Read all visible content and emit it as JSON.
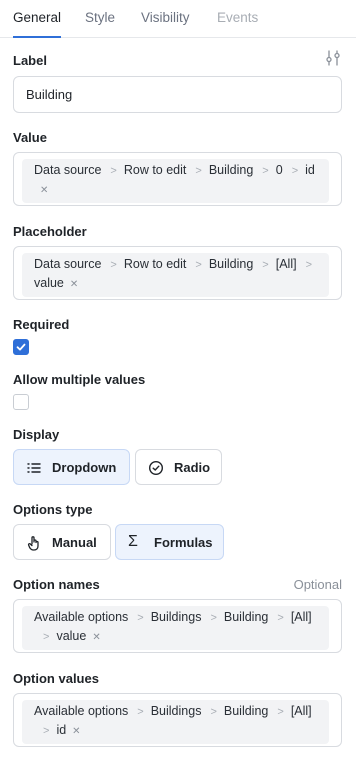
{
  "tabs": [
    {
      "label": "General",
      "state": "active"
    },
    {
      "label": "Style",
      "state": "normal"
    },
    {
      "label": "Visibility",
      "state": "normal"
    },
    {
      "label": "Events",
      "state": "disabled"
    }
  ],
  "label_field": {
    "label": "Label",
    "value": "Building"
  },
  "value_field": {
    "label": "Value",
    "path": [
      "Data source",
      "Row to edit",
      "Building",
      "0",
      "id"
    ]
  },
  "placeholder_field": {
    "label": "Placeholder",
    "path": [
      "Data source",
      "Row to edit",
      "Building",
      "[All]",
      "value"
    ]
  },
  "required": {
    "label": "Required",
    "checked": true
  },
  "allow_multiple": {
    "label": "Allow multiple values",
    "checked": false
  },
  "display": {
    "label": "Display",
    "options": [
      {
        "label": "Dropdown",
        "icon": "list-icon",
        "selected": true
      },
      {
        "label": "Radio",
        "icon": "check-circle-icon",
        "selected": false
      }
    ]
  },
  "options_type": {
    "label": "Options type",
    "options": [
      {
        "label": "Manual",
        "icon": "hand-pointer-icon",
        "selected": false
      },
      {
        "label": "Formulas",
        "icon": "sigma-icon",
        "selected": true
      }
    ]
  },
  "option_names": {
    "label": "Option names",
    "optional": "Optional",
    "path": [
      "Available options",
      "Buildings",
      "Building",
      "[All]",
      "value"
    ]
  },
  "option_values": {
    "label": "Option values",
    "path": [
      "Available options",
      "Buildings",
      "Building",
      "[All]",
      "id"
    ]
  },
  "colors": {
    "accent": "#2f6fd8",
    "selected_bg": "#edf3fd",
    "pill_bg": "#f2f3f5"
  }
}
